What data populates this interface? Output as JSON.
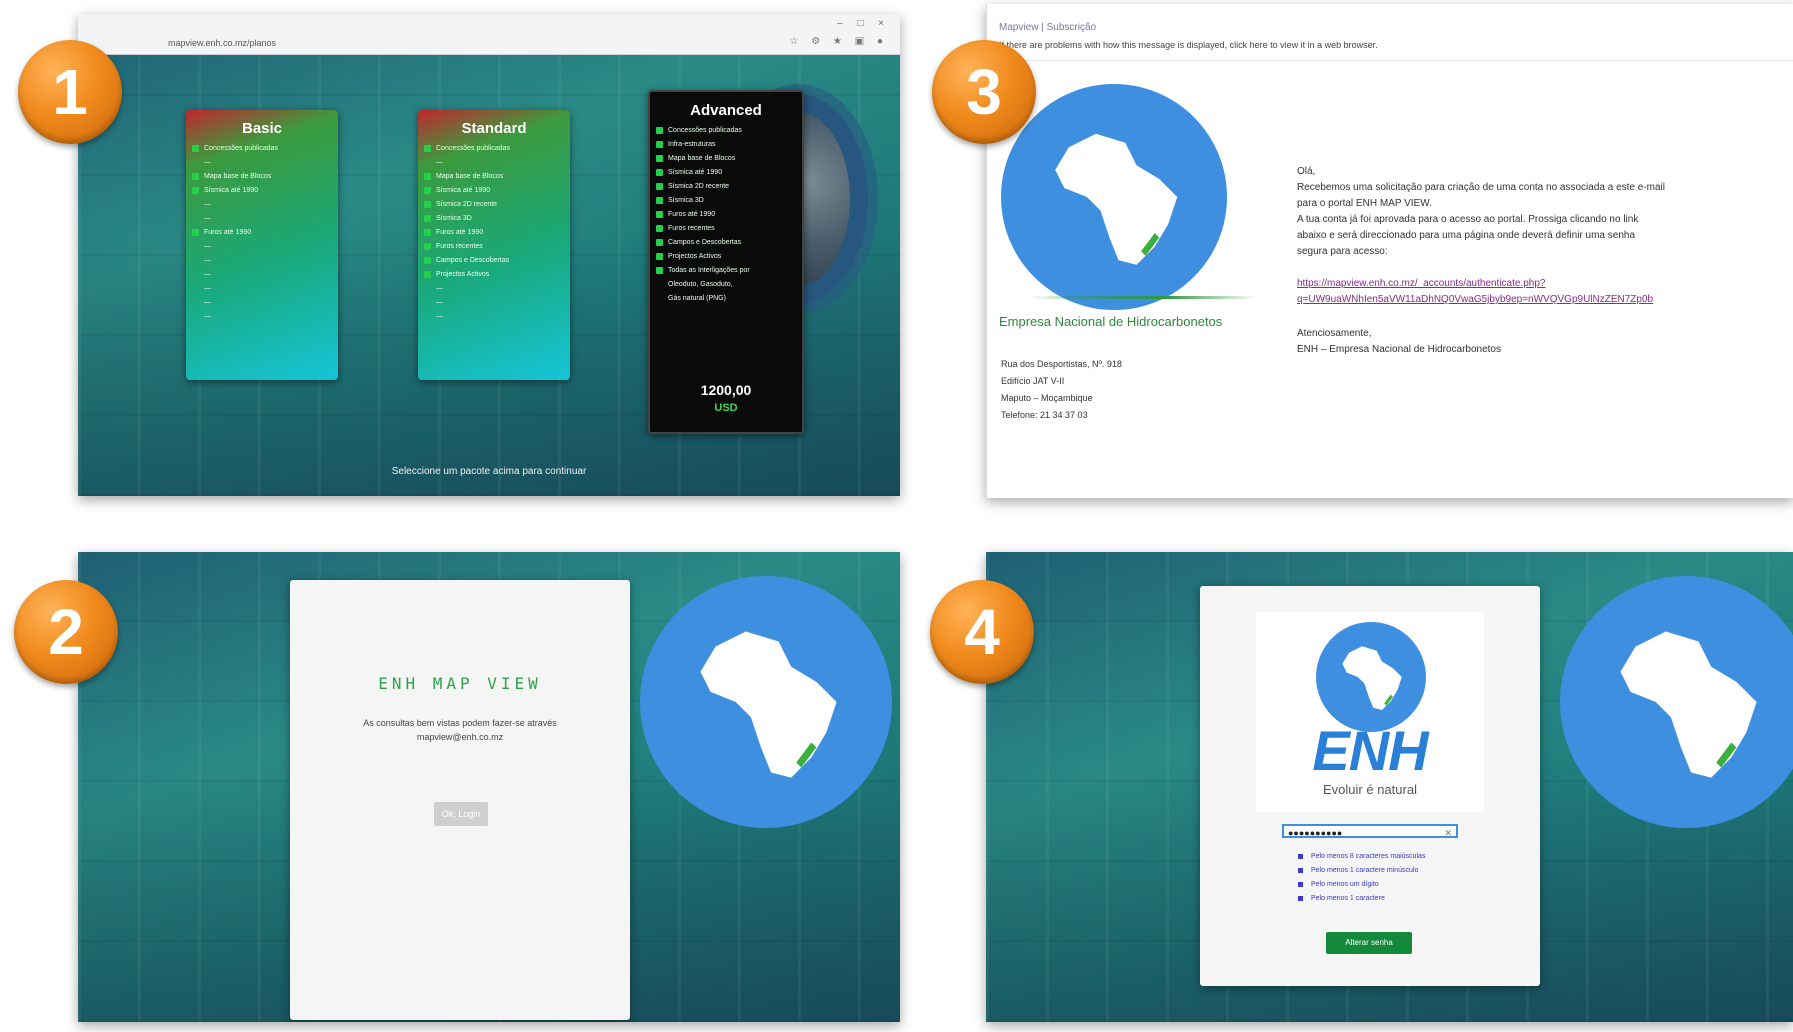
{
  "badges": {
    "one": "1",
    "two": "2",
    "three": "3",
    "four": "4"
  },
  "panel1": {
    "browser": {
      "url": "mapview.enh.co.mz/planos",
      "window_controls": "– □ ×",
      "toolbar_icons": "☆ ⚙ ★ ▣ ●"
    },
    "plans": [
      {
        "title": "Basic",
        "color_top": "#c2262e",
        "color": "#1fa55a",
        "features": [
          {
            "text": "Concessões publicadas",
            "on": true
          },
          {
            "text": "—",
            "on": false
          },
          {
            "text": "Mapa base de Blocos",
            "on": true
          },
          {
            "text": "Sísmica até 1990",
            "on": true
          },
          {
            "text": "—",
            "on": false
          },
          {
            "text": "—",
            "on": false
          },
          {
            "text": "Furos até 1990",
            "on": true
          },
          {
            "text": "—",
            "on": false
          },
          {
            "text": "—",
            "on": false
          },
          {
            "text": "—",
            "on": false
          },
          {
            "text": "—",
            "on": false
          },
          {
            "text": "—",
            "on": false
          },
          {
            "text": "—",
            "on": false
          }
        ]
      },
      {
        "title": "Standard",
        "color_top": "#c2262e",
        "color": "#1fa55a",
        "features": [
          {
            "text": "Concessões publicadas",
            "on": true
          },
          {
            "text": "—",
            "on": false
          },
          {
            "text": "Mapa base de Blocos",
            "on": true
          },
          {
            "text": "Sísmica até 1990",
            "on": true
          },
          {
            "text": "Sísmica 2D recente",
            "on": true
          },
          {
            "text": "Sísmica 3D",
            "on": true
          },
          {
            "text": "Furos até 1990",
            "on": true
          },
          {
            "text": "Furos recentes",
            "on": true
          },
          {
            "text": "Campos e Descobertas",
            "on": true
          },
          {
            "text": "Projectos Activos",
            "on": true
          },
          {
            "text": "—",
            "on": false
          },
          {
            "text": "—",
            "on": false
          },
          {
            "text": "—",
            "on": false
          }
        ]
      },
      {
        "title": "Advanced",
        "color": "#0a0a0a",
        "features": [
          {
            "text": "Concessões publicadas",
            "on": true
          },
          {
            "text": "Infra-estruturas",
            "on": true
          },
          {
            "text": "Mapa base de Blocos",
            "on": true
          },
          {
            "text": "Sísmica até 1990",
            "on": true
          },
          {
            "text": "Sísmica 2D recente",
            "on": true
          },
          {
            "text": "Sísmica 3D",
            "on": true
          },
          {
            "text": "Furos até 1990",
            "on": true
          },
          {
            "text": "Furos recentes",
            "on": true
          },
          {
            "text": "Campos e Descobertas",
            "on": true
          },
          {
            "text": "Projectos Activos",
            "on": true
          },
          {
            "text": "Todas as Interligações por",
            "on": true
          },
          {
            "text": "Oleoduto, Gasoduto,",
            "on": false
          },
          {
            "text": "Gás natural (PNG)",
            "on": false
          }
        ],
        "price": "1200,00",
        "currency": "USD"
      }
    ],
    "select_hint": "Seleccione um pacote acima para continuar"
  },
  "panel2": {
    "title": "ENH MAP VIEW",
    "message_line1": "As consultas bem vistas podem fazer-se através",
    "message_line2": "mapview@enh.co.mz",
    "button": "Ok, Login"
  },
  "panel3": {
    "from": "Mapview | Subscrição",
    "notice": "If there are problems with how this message is displayed, click here to view it in a web browser.",
    "greeting": "Olá,",
    "body_line1": "Recebemos uma solicitação para criação de uma conta no associada a este e-mail",
    "body_line2": "para o portal ENH MAP VIEW.",
    "body_line3": "A tua conta já foi aprovada para o acesso ao portal. Prossiga clicando no link",
    "body_line4": "abaixo e será direccionado para uma página onde deverá definir uma senha",
    "body_line5": "segura para acesso:",
    "link_line1": "https://mapview.enh.co.mz/_accounts/authenticate.php?",
    "link_line2": "q=UW9uaWNhIen5aVW11aDhNQ0VwaG5jbyb9ep=nWVQVGp9UlNzZEN7Zp0b",
    "signoff": "Atenciosamente,",
    "signature": "ENH – Empresa Nacional de Hidrocarbonetos",
    "company": "Empresa Nacional de Hidrocarbonetos",
    "address_line1": "Rua dos Desportistas, Nº. 918",
    "address_line2": "Edifício JAT V-II",
    "address_line3": "Maputo – Moçambique",
    "address_line4": "Telefone: 21 34 37 03"
  },
  "panel4": {
    "brand": "ENH",
    "tagline": "Evoluir é natural",
    "password_value": "●●●●●●●●●●",
    "password_clear": "✕",
    "rules": [
      "Pelo menos 8 caracteres maiúsculas",
      "Pelo menos 1 caractere minúsculo",
      "Pelo menos um dígito",
      "Pelo menos 1 caractere"
    ],
    "button": "Alterar senha"
  },
  "colors": {
    "teal": "#1f7c7a",
    "logo_blue": "#3e8fe0",
    "brand_green": "#2ea24a",
    "badge_orange": "#f08a1c"
  }
}
